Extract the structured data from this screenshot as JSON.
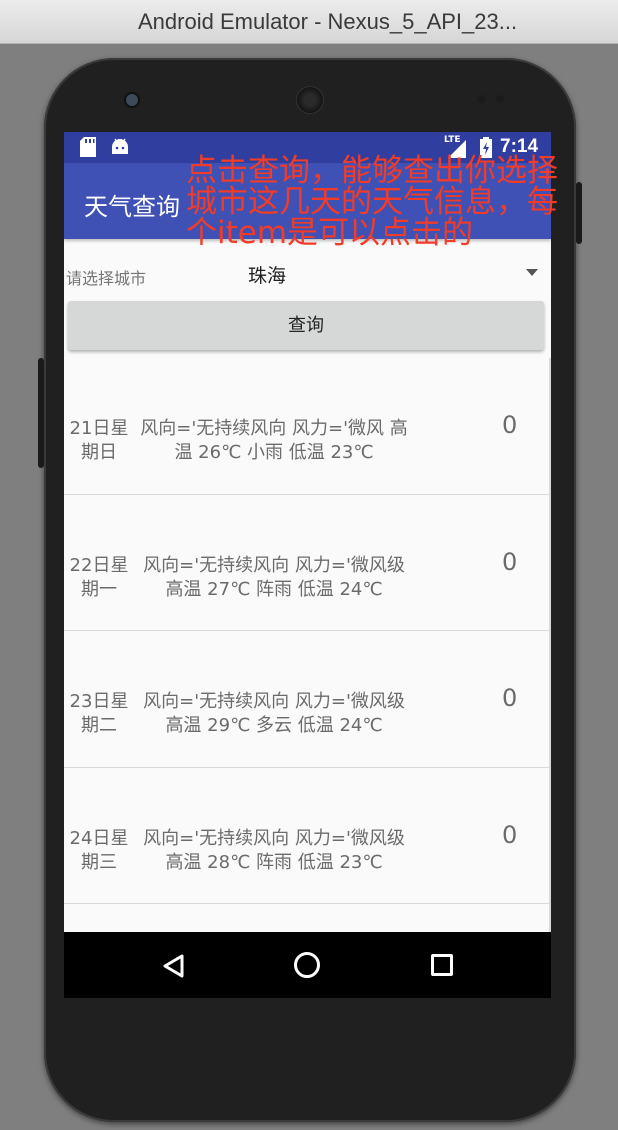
{
  "window": {
    "title": "Android Emulator - Nexus_5_API_23..."
  },
  "status_bar": {
    "network": "LTE",
    "time": "7:14"
  },
  "app": {
    "title": "天气查询",
    "city_label": "请选择城市",
    "selected_city": "珠海",
    "query_button": "查询"
  },
  "weather_items": [
    {
      "date": "21日星期日",
      "detail": "风向='无持续风向 风力='微风 高温 26℃ 小雨 低温 23℃",
      "count": "0"
    },
    {
      "date": "22日星期一",
      "detail": "风向='无持续风向 风力='微风级 高温 27℃ 阵雨 低温 24℃",
      "count": "0"
    },
    {
      "date": "23日星期二",
      "detail": "风向='无持续风向 风力='微风级 高温 29℃ 多云 低温 24℃",
      "count": "0"
    },
    {
      "date": "24日星期三",
      "detail": "风向='无持续风向 风力='微风级 高温 28℃ 阵雨 低温 23℃",
      "count": "0"
    }
  ],
  "annotation": {
    "text": "点击查询，能够查出你选择城市这几天的天气信息，每个item是可以点击的"
  },
  "colors": {
    "primary": "#3f51b5",
    "primary_dark": "#303f9f",
    "annotation": "#f03c28"
  }
}
